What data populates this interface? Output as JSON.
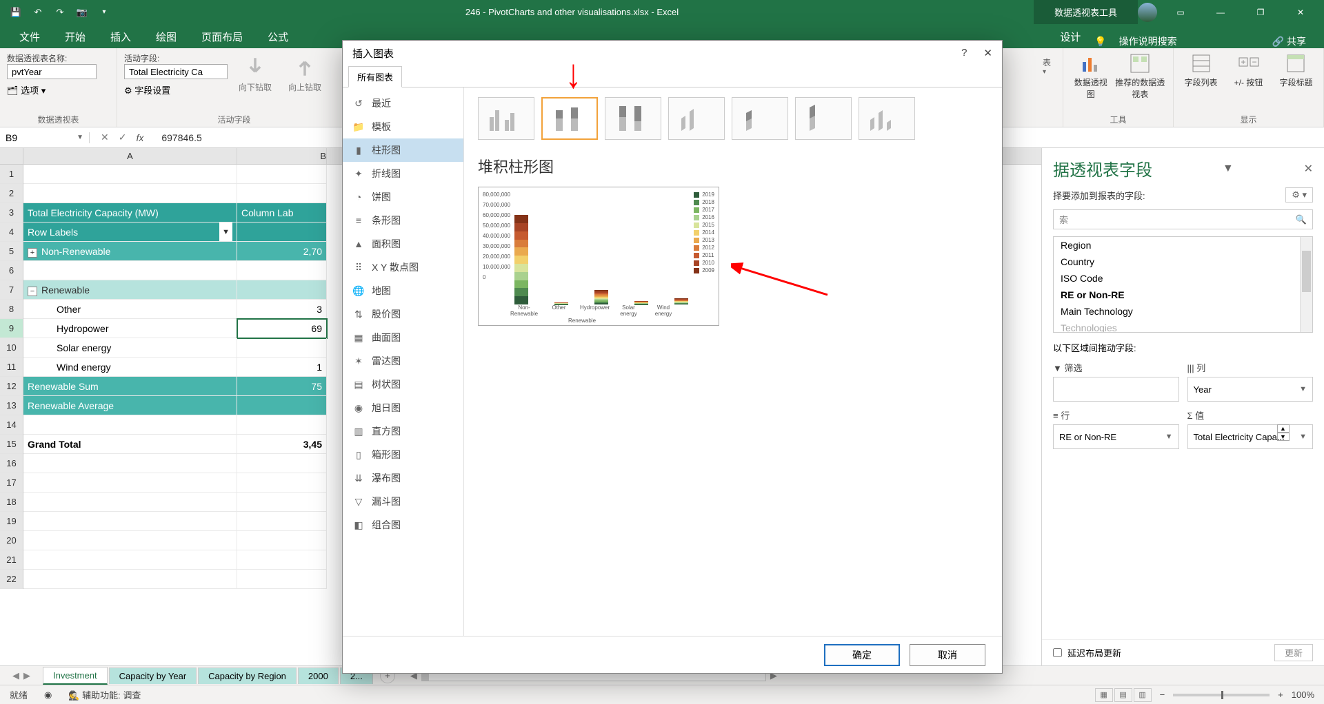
{
  "titlebar": {
    "filename": "246 - PivotCharts and other visualisations.xlsx - Excel",
    "context_tools": "数据透视表工具"
  },
  "ribbon_tabs": [
    "文件",
    "开始",
    "插入",
    "绘图",
    "页面布局",
    "公式"
  ],
  "ribbon_tabs_right": [
    "设计"
  ],
  "ribbon_right": {
    "tell_me": "操作说明搜索",
    "share": "共享"
  },
  "ribbon": {
    "pivot_name_label": "数据透视表名称:",
    "pivot_name_value": "pvtYear",
    "options": "选项",
    "pivot_group": "数据透视表",
    "active_field_label": "活动字段:",
    "active_field_value": "Total Electricity Ca",
    "field_settings": "字段设置",
    "drill_down": "向下钻取",
    "drill_up": "向上钻取",
    "active_field_group": "活动字段",
    "tools": {
      "pivotchart": "数据透视图",
      "recommend": "推荐的数据透视表",
      "group": "工具",
      "field_list": "字段列表",
      "pm_buttons": "+/- 按钮",
      "field_headers": "字段标题",
      "show_group": "显示",
      "partial": "表"
    }
  },
  "namebox": "B9",
  "formula": "697846.5",
  "columns": [
    "A",
    "B"
  ],
  "rows": [
    "1",
    "2",
    "3",
    "4",
    "5",
    "6",
    "7",
    "8",
    "9",
    "10",
    "11",
    "12",
    "13",
    "14",
    "15",
    "16",
    "17",
    "18",
    "19",
    "20",
    "21",
    "22"
  ],
  "pivot": {
    "title": "Total Electricity Capacity (MW)",
    "col_label": "Column Lab",
    "row_labels": "Row Labels",
    "nonre": "Non-Renewable",
    "nonre_val": "2,70",
    "renewable": "Renewable",
    "other": "Other",
    "other_val": "3",
    "hydropower": "Hydropower",
    "hydropower_val": "69",
    "solar": "Solar energy",
    "wind": "Wind energy",
    "wind_val": "1",
    "ren_sum": "Renewable Sum",
    "ren_sum_val": "75",
    "ren_avg": "Renewable Average",
    "grand_total": "Grand Total",
    "grand_val": "3,45"
  },
  "dialog": {
    "title": "插入图表",
    "help": "?",
    "tab_all": "所有图表",
    "chart_types": [
      {
        "icon": "recent",
        "label": "最近"
      },
      {
        "icon": "template",
        "label": "模板"
      },
      {
        "icon": "column",
        "label": "柱形图"
      },
      {
        "icon": "line",
        "label": "折线图"
      },
      {
        "icon": "pie",
        "label": "饼图"
      },
      {
        "icon": "bar",
        "label": "条形图"
      },
      {
        "icon": "area",
        "label": "面积图"
      },
      {
        "icon": "xy",
        "label": "X Y 散点图"
      },
      {
        "icon": "map",
        "label": "地图"
      },
      {
        "icon": "stock",
        "label": "股价图"
      },
      {
        "icon": "surface",
        "label": "曲面图"
      },
      {
        "icon": "radar",
        "label": "雷达图"
      },
      {
        "icon": "treemap",
        "label": "树状图"
      },
      {
        "icon": "sunburst",
        "label": "旭日图"
      },
      {
        "icon": "histogram",
        "label": "直方图"
      },
      {
        "icon": "boxw",
        "label": "箱形图"
      },
      {
        "icon": "waterfall",
        "label": "瀑布图"
      },
      {
        "icon": "funnel",
        "label": "漏斗图"
      },
      {
        "icon": "combo",
        "label": "组合图"
      }
    ],
    "selected_type_index": 2,
    "preview_title": "堆积柱形图",
    "ok": "确定",
    "cancel": "取消"
  },
  "chart_data": {
    "type": "stacked-bar",
    "title": "",
    "ylabel": "",
    "ylim": [
      0,
      80000000
    ],
    "yticks": [
      "80,000,000",
      "70,000,000",
      "60,000,000",
      "50,000,000",
      "40,000,000",
      "30,000,000",
      "20,000,000",
      "10,000,000",
      "0"
    ],
    "categories": [
      "Non-Renewable",
      "Other",
      "Hydropower",
      "Solar energy",
      "Wind energy"
    ],
    "category_group_label": "Renewable",
    "legend_years": [
      "2019",
      "2018",
      "2017",
      "2016",
      "2015",
      "2014",
      "2013",
      "2012",
      "2011",
      "2010",
      "2009"
    ],
    "approx_totals": [
      75000000,
      2000000,
      12000000,
      3000000,
      5000000
    ]
  },
  "field_pane": {
    "title": "据透视表字段",
    "subtitle": "择要添加到报表的字段:",
    "search_placeholder": "索",
    "fields": [
      "Region",
      "Country",
      "ISO Code",
      "RE or Non-RE",
      "Main Technology",
      "Technologies"
    ],
    "bold_field_index": 3,
    "drag_msg": "以下区域间拖动字段:",
    "zones": {
      "filters": "筛选",
      "columns": "列",
      "rows": "行",
      "values": "值",
      "columns_value": "Year",
      "rows_value": "RE or Non-RE",
      "values_value": "Total Electricity Capa..."
    },
    "defer": "延迟布局更新",
    "update": "更新"
  },
  "sheet_tabs": [
    "Investment",
    "Capacity by Year",
    "Capacity by Region",
    "2000",
    "2..."
  ],
  "active_sheet_index": 0,
  "status": {
    "ready": "就绪",
    "accessibility": "辅助功能: 调查",
    "zoom": "100%"
  }
}
